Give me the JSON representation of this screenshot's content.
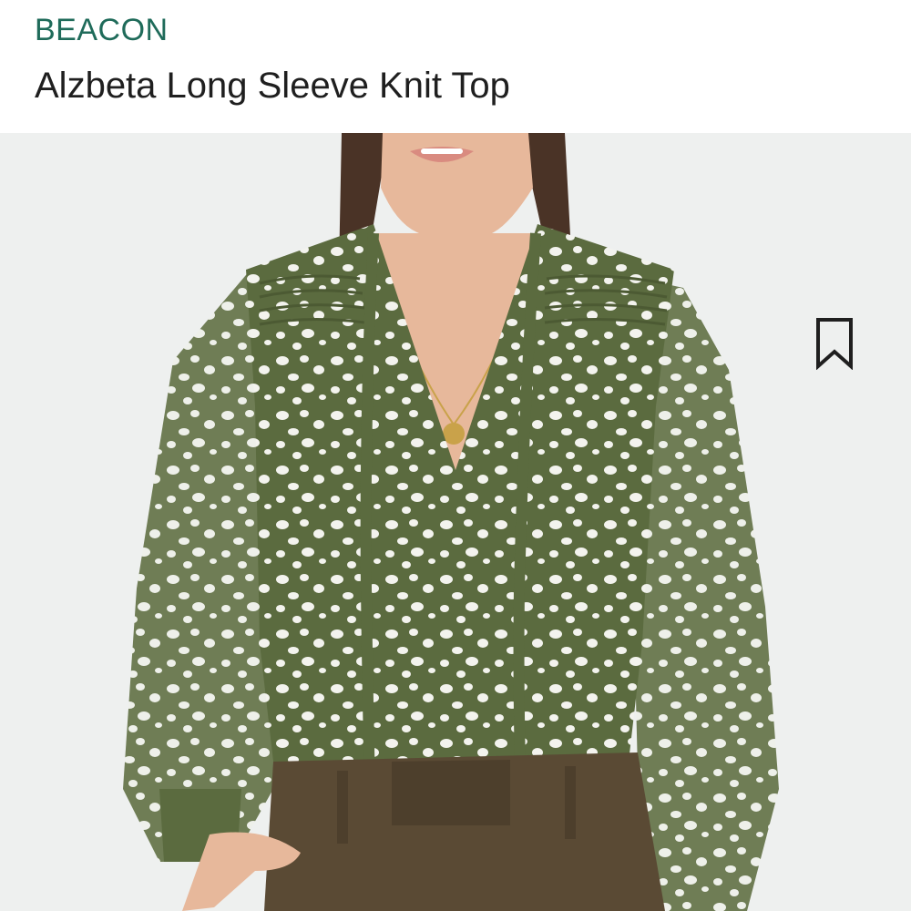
{
  "product": {
    "brand": "BEACON",
    "title": "Alzbeta Long Sleeve Knit Top"
  },
  "icons": {
    "save": "bookmark-icon"
  },
  "colors": {
    "brand": "#1f6b5a",
    "title": "#1f1f1f",
    "image_background": "#eef0ef",
    "top_green": "#5b6b3f",
    "pattern_white": "#f3f3ee",
    "pants_brown": "#5a4a34"
  }
}
